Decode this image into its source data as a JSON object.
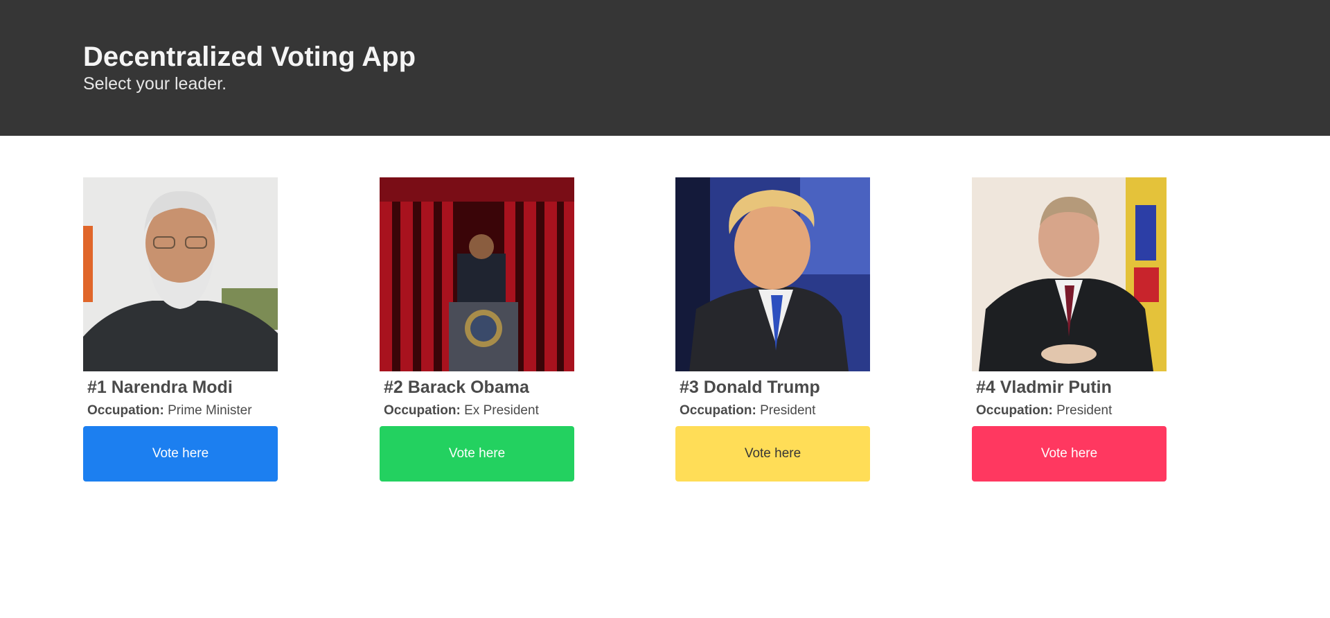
{
  "hero": {
    "title": "Decentralized Voting App",
    "subtitle": "Select your leader."
  },
  "occupation_label": "Occupation:",
  "candidates": [
    {
      "title": "#1 Narendra Modi",
      "occupation": "Prime Minister",
      "vote_label": "Vote here",
      "button_color": "#1c7ff0",
      "button_text_color": "#ffffff",
      "photo": "portrait-photo-white-beard-dark-jacket"
    },
    {
      "title": "#2 Barack Obama",
      "occupation": "Ex President",
      "vote_label": "Vote here",
      "button_color": "#23d160",
      "button_text_color": "#ffffff",
      "photo": "speech-photo-red-curtain-podium-seal"
    },
    {
      "title": "#3 Donald Trump",
      "occupation": "President",
      "vote_label": "Vote here",
      "button_color": "#ffdd57",
      "button_text_color": "#363636",
      "photo": "portrait-photo-blue-tie-blue-background"
    },
    {
      "title": "#4 Vladmir Putin",
      "occupation": "President",
      "vote_label": "Vote here",
      "button_color": "#ff3860",
      "button_text_color": "#ffffff",
      "photo": "portrait-photo-seated-flag-background"
    }
  ],
  "colors": {
    "hero_bg": "#363636",
    "text": "#4a4a4a"
  }
}
